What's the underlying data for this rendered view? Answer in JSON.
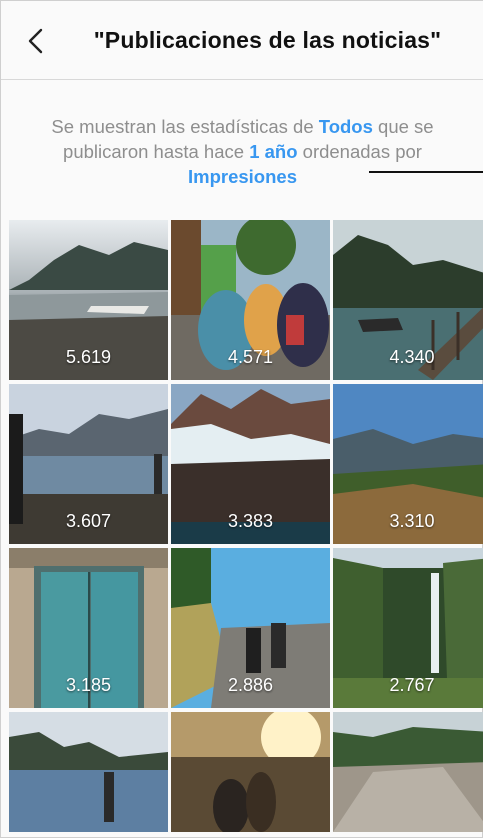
{
  "header": {
    "title": "\"Publicaciones de las noticias\""
  },
  "info": {
    "part1": "Se muestran las estadísticas de ",
    "link_type": "Todos",
    "part2": " que se publicaron hasta hace ",
    "link_period": "1 año",
    "part3": " ordenadas por ",
    "link_sort": "Impresiones"
  },
  "posts": [
    {
      "count": "5.619"
    },
    {
      "count": "4.571"
    },
    {
      "count": "4.340"
    },
    {
      "count": "3.607"
    },
    {
      "count": "3.383"
    },
    {
      "count": "3.310"
    },
    {
      "count": "3.185"
    },
    {
      "count": "2.886"
    },
    {
      "count": "2.767"
    }
  ],
  "colors": {
    "link": "#3897f0",
    "muted_text": "#8e8e8e",
    "background": "#fafafa"
  }
}
